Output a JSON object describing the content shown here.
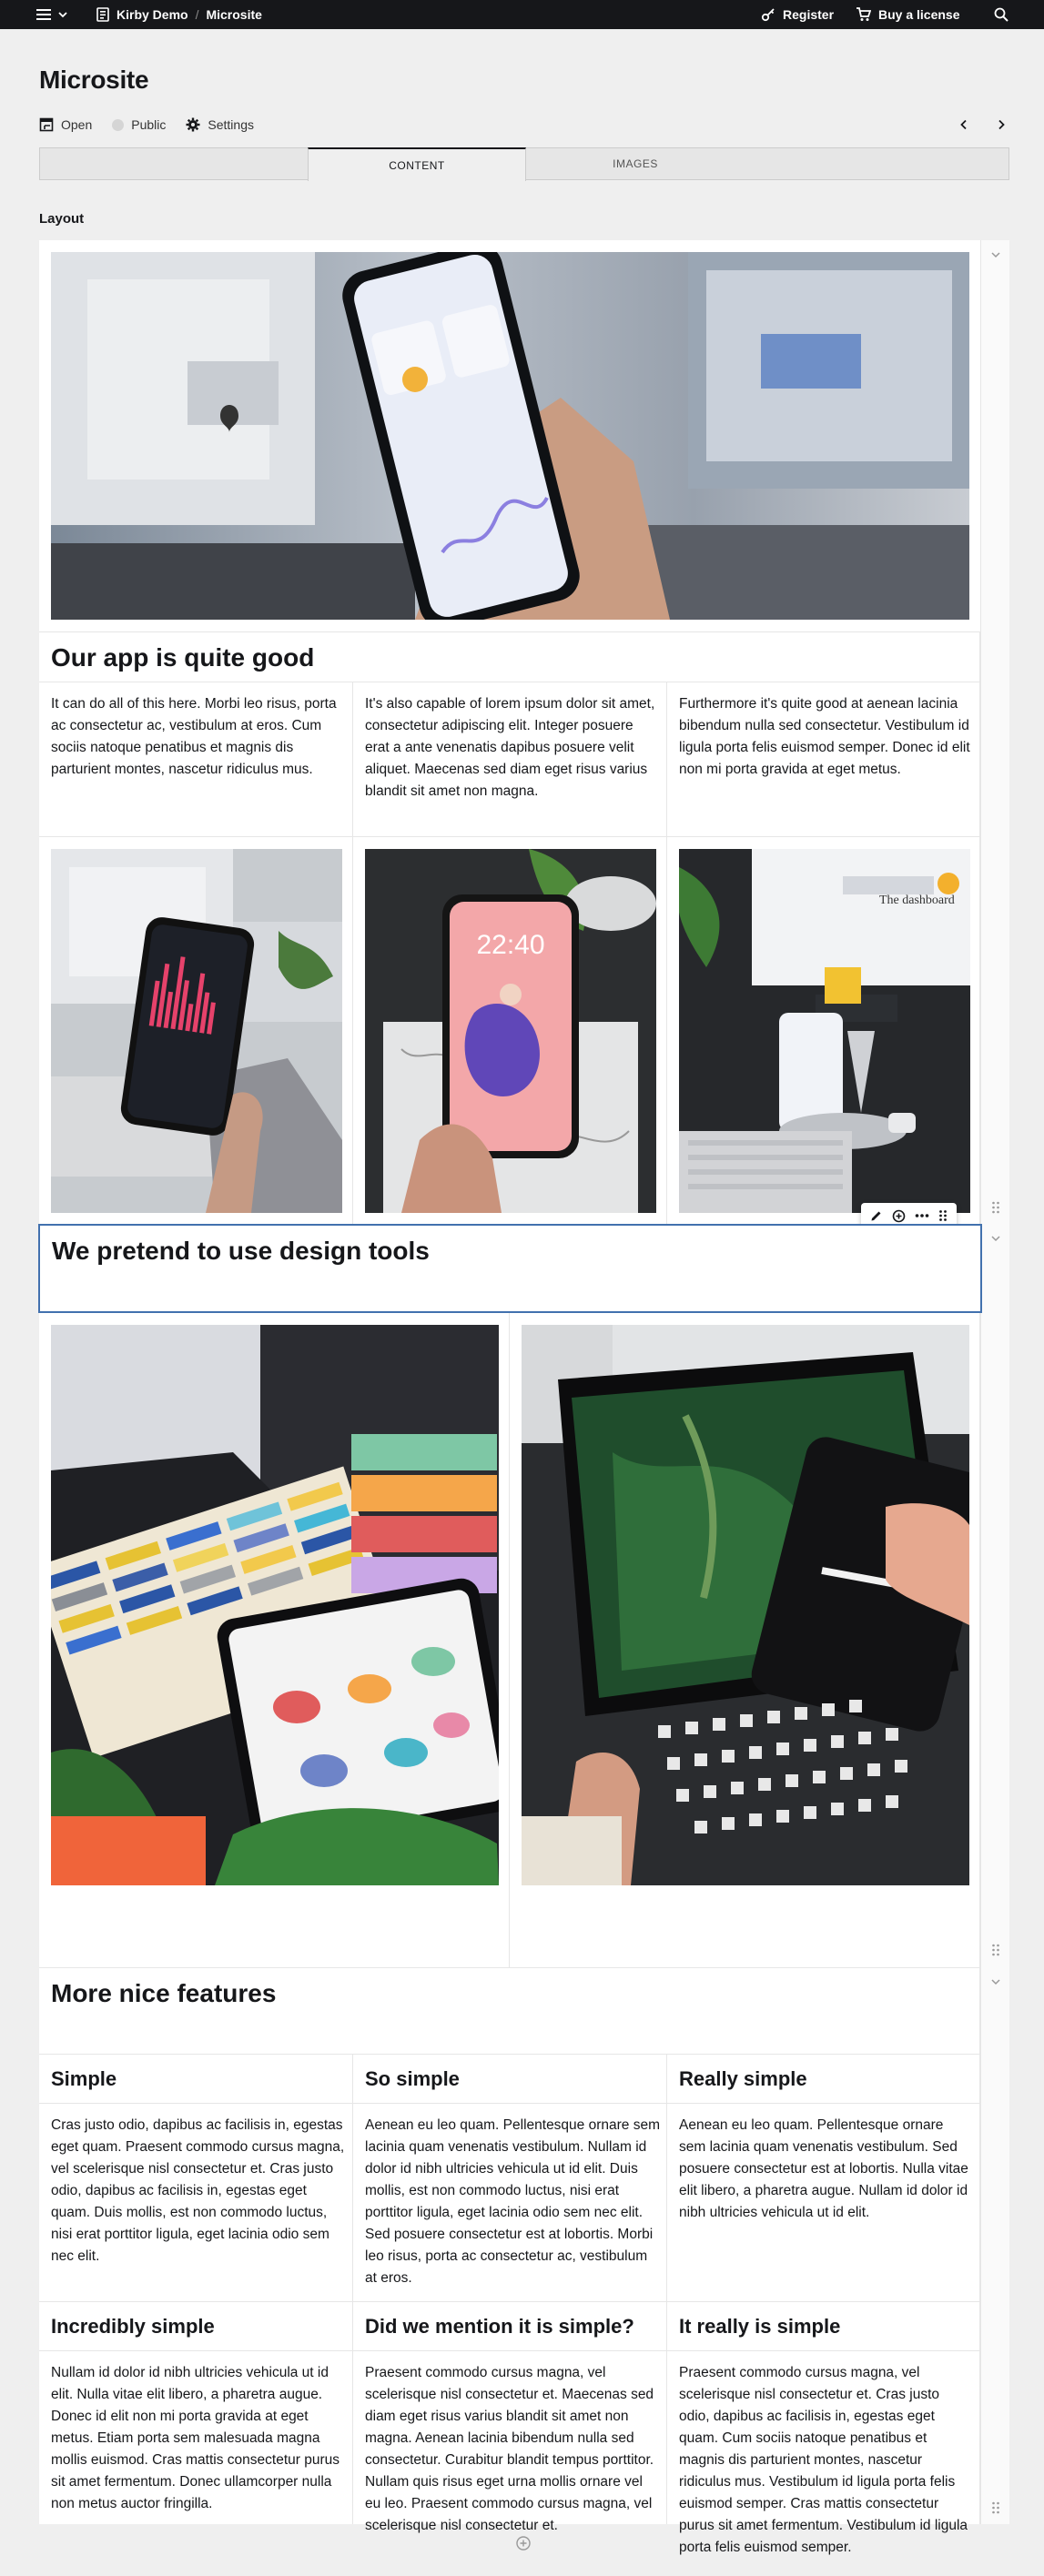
{
  "topbar": {
    "site": "Kirby Demo",
    "separator": "/",
    "page": "Microsite",
    "register": "Register",
    "license": "Buy a license"
  },
  "header": {
    "title": "Microsite",
    "status_open": "Open",
    "status_public": "Public",
    "settings": "Settings"
  },
  "tabs": [
    {
      "label": ""
    },
    {
      "label": "CONTENT"
    },
    {
      "label": "IMAGES"
    }
  ],
  "section_label": "Layout",
  "layout": {
    "row1": {
      "heading": "Our app is quite good",
      "col1": "It can do all of this here. Morbi leo risus, porta ac consectetur ac, vestibulum at eros. Cum sociis natoque penatibus et magnis dis parturient montes, nascetur ridiculus mus.",
      "col2": "It's also capable of lorem ipsum dolor sit amet, consectetur adipiscing elit. Integer posuere erat a ante venenatis dapibus posuere velit aliquet. Maecenas sed diam eget risus varius blandit sit amet non magna.",
      "col3": "Furthermore it's quite good at aenean lacinia bibendum nulla sed consectetur. Vestibulum id ligula porta felis euismod semper. Donec id elit non mi porta gravida at eget metus."
    },
    "row2": {
      "heading": "We pretend to use design tools"
    },
    "row3": {
      "heading": "More nice features",
      "features": [
        {
          "title": "Simple",
          "text": "Cras justo odio, dapibus ac facilisis in, egestas eget quam. Praesent commodo cursus magna, vel scelerisque nisl consectetur et. Cras justo odio, dapibus ac facilisis in, egestas eget quam. Duis mollis, est non commodo luctus, nisi erat porttitor ligula, eget lacinia odio sem nec elit."
        },
        {
          "title": "So simple",
          "text": "Aenean eu leo quam. Pellentesque ornare sem lacinia quam venenatis vestibulum. Nullam id dolor id nibh ultricies vehicula ut id elit. Duis mollis, est non commodo luctus, nisi erat porttitor ligula, eget lacinia odio sem nec elit. Sed posuere consectetur est at lobortis. Morbi leo risus, porta ac consectetur ac, vestibulum at eros."
        },
        {
          "title": "Really simple",
          "text": "Aenean eu leo quam. Pellentesque ornare sem lacinia quam venenatis vestibulum. Sed posuere consectetur est at lobortis. Nulla vitae elit libero, a pharetra augue. Nullam id dolor id nibh ultricies vehicula ut id elit."
        },
        {
          "title": "Incredibly simple",
          "text": "Nullam id dolor id nibh ultricies vehicula ut id elit. Nulla vitae elit libero, a pharetra augue. Donec id elit non mi porta gravida at eget metus. Etiam porta sem malesuada magna mollis euismod. Cras mattis consectetur purus sit amet fermentum. Donec ullamcorper nulla non metus auctor fringilla."
        },
        {
          "title": "Did we mention it is simple?",
          "text": "Praesent commodo cursus magna, vel scelerisque nisl consectetur et. Maecenas sed diam eget risus varius blandit sit amet non magna. Aenean lacinia bibendum nulla sed consectetur. Curabitur blandit tempus porttitor. Nullam quis risus eget urna mollis ornare vel eu leo. Praesent commodo cursus magna, vel scelerisque nisl consectetur et."
        },
        {
          "title": "It really is simple",
          "text": "Praesent commodo cursus magna, vel scelerisque nisl consectetur et. Cras justo odio, dapibus ac facilisis in, egestas eget quam. Cum sociis natoque penatibus et magnis dis parturient montes, nascetur ridiculus mus. Vestibulum id ligula porta felis euismod semper. Cras mattis consectetur purus sit amet fermentum. Vestibulum id ligula porta felis euismod semper."
        }
      ]
    }
  },
  "colors": {
    "topbar": "#16171a",
    "page_bg": "#efefef",
    "focus": "#4271ae"
  }
}
